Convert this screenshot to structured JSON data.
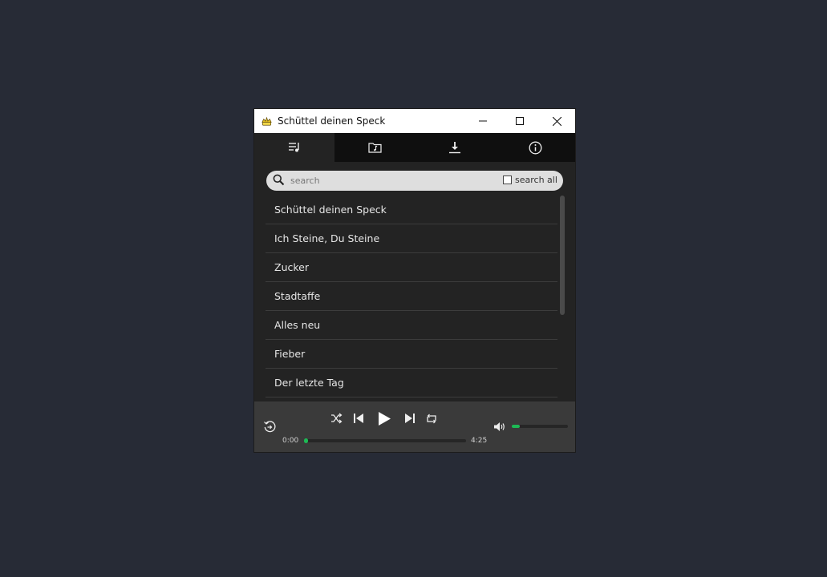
{
  "window": {
    "title": "Schüttel deinen Speck",
    "controls": {
      "minimize": "minimize-icon",
      "maximize": "maximize-icon",
      "close": "close-icon"
    }
  },
  "tabs": [
    {
      "icon": "playlist-icon",
      "active": true
    },
    {
      "icon": "music-folder-icon",
      "active": false
    },
    {
      "icon": "download-icon",
      "active": false
    },
    {
      "icon": "info-icon",
      "active": false
    }
  ],
  "search": {
    "placeholder": "search",
    "value": "",
    "search_all_label": "search all",
    "search_all_checked": false
  },
  "tracks": [
    "Schüttel deinen Speck",
    "Ich Steine, Du Steine",
    "Zucker",
    "Stadtaffe",
    "Alles neu",
    "Fieber",
    "Der letzte Tag"
  ],
  "player": {
    "current_time": "0:00",
    "total_time": "4:25",
    "progress": 0.0,
    "volume": 0.14,
    "icons": [
      "repeat-one-icon",
      "shuffle-icon",
      "previous-icon",
      "play-icon",
      "next-icon",
      "repeat-icon",
      "volume-icon"
    ]
  },
  "colors": {
    "accent": "#1db954",
    "background": "#272b36",
    "window": "#232323",
    "tabbar": "#0f0f0f",
    "player": "#3a3a3a"
  }
}
